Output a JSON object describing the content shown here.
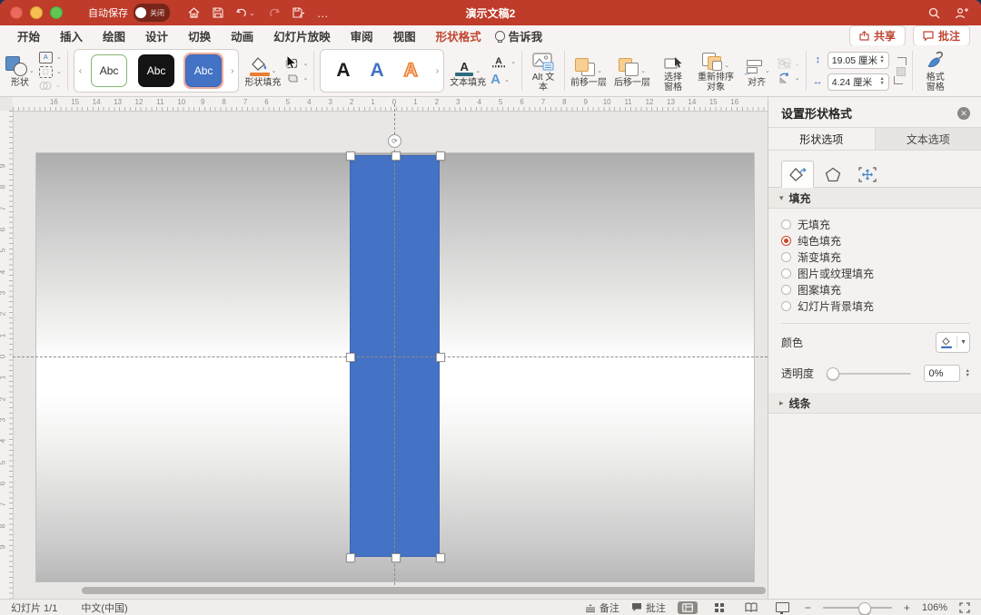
{
  "titlebar": {
    "autosave_label": "自动保存",
    "autosave_state": "关闭",
    "title": "演示文稿2"
  },
  "menubar": {
    "tabs": [
      "开始",
      "插入",
      "绘图",
      "设计",
      "切换",
      "动画",
      "幻灯片放映",
      "审阅",
      "视图",
      "形状格式"
    ],
    "active_tab": "形状格式",
    "tellme_label": "告诉我",
    "share_label": "共享",
    "comments_label": "批注"
  },
  "ribbon": {
    "shapes_label": "形状",
    "style_gallery": {
      "items": [
        "Abc",
        "Abc",
        "Abc"
      ],
      "selected_index": 2
    },
    "shape_fill_label": "形状填充",
    "text_gallery": {
      "items": [
        "A",
        "A",
        "A"
      ]
    },
    "text_fill_label": "文本填充",
    "alt_text_label": "Alt 文本",
    "arrange": {
      "bring_forward_label": "前移一层",
      "send_backward_label": "后移一层",
      "selection_pane_label": "选择窗格",
      "reorder_label": "重新排序对象",
      "align_label": "对齐"
    },
    "size": {
      "height_value": "19.05 厘米",
      "width_value": "4.24 厘米"
    },
    "format_pane_label": "格式窗格"
  },
  "panel": {
    "title": "设置形状格式",
    "tabs": {
      "shape": "形状选项",
      "text": "文本选项",
      "active": "形状选项"
    },
    "fill": {
      "section_label": "填充",
      "options": [
        "无填充",
        "纯色填充",
        "渐变填充",
        "图片或纹理填充",
        "图案填充",
        "幻灯片背景填充"
      ],
      "selected_option": "纯色填充",
      "color_label": "颜色",
      "transparency_label": "透明度",
      "transparency_value": "0%"
    },
    "line_section_label": "线条"
  },
  "canvas": {
    "h_ruler_numbers": [
      16,
      15,
      14,
      13,
      12,
      11,
      10,
      9,
      8,
      7,
      6,
      5,
      4,
      3,
      2,
      1,
      0,
      1,
      2,
      3,
      4,
      5,
      6,
      7,
      8,
      9,
      10,
      11,
      12,
      13,
      14,
      15,
      16
    ],
    "v_ruler_numbers": [
      9,
      8,
      7,
      6,
      5,
      4,
      3,
      2,
      1,
      0,
      1,
      2,
      3,
      4,
      5,
      6,
      7,
      8,
      9
    ],
    "shape_fill_color": "#4472c4"
  },
  "statusbar": {
    "slide_label": "幻灯片 1/1",
    "language_label": "中文(中国)",
    "notes_label": "备注",
    "comments_label": "批注",
    "zoom_value": "106%"
  },
  "colors": {
    "accent_red": "#c0452c",
    "office_blue": "#4472c4",
    "selection_orange": "#ed7d31",
    "title_bar_red": "#bf3b2a"
  }
}
